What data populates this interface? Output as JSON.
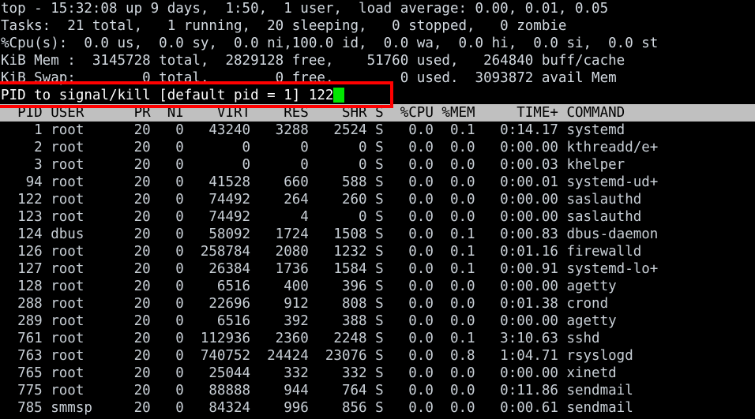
{
  "terminal": {
    "background_color": "#000000",
    "foreground_color": "#cfd6de",
    "header_bar_bg": "#c0c0c0",
    "header_bar_fg": "#000000",
    "cursor_color": "#00e800",
    "annotation_color": "#ff0000"
  },
  "summary": {
    "uptime_line": "top - 15:32:08 up 9 days,  1:50,  1 user,  load average: 0.00, 0.01, 0.05",
    "tasks_line": "Tasks:  21 total,   1 running,  20 sleeping,   0 stopped,   0 zombie",
    "cpu_line": "%Cpu(s):  0.0 us,  0.0 sy,  0.0 ni,100.0 id,  0.0 wa,  0.0 hi,  0.0 si,  0.0 st",
    "mem_line": "KiB Mem :  3145728 total,  2829128 free,    51760 used,   264840 buff/cache",
    "swap_line": "KiB Swap:        0 total,        0 free,        0 used.  3093872 avail Mem",
    "fields": {
      "time": "15:32:08",
      "up_days": "9 days",
      "up_time": "1:50",
      "users": "1 user",
      "load_avg_1": "0.00",
      "load_avg_5": "0.01",
      "load_avg_15": "0.05",
      "tasks_total": "21",
      "tasks_running": "1",
      "tasks_sleeping": "20",
      "tasks_stopped": "0",
      "tasks_zombie": "0",
      "cpu_us": "0.0",
      "cpu_sy": "0.0",
      "cpu_ni": "0.0",
      "cpu_id": "100.0",
      "cpu_wa": "0.0",
      "cpu_hi": "0.0",
      "cpu_si": "0.0",
      "cpu_st": "0.0",
      "mem_total": "3145728",
      "mem_free": "2829128",
      "mem_used": "51760",
      "mem_buff_cache": "264840",
      "swap_total": "0",
      "swap_free": "0",
      "swap_used": "0",
      "avail_mem": "3093872"
    }
  },
  "prompt": {
    "text": "PID to signal/kill [default pid = 1] ",
    "typed_value": "122",
    "full_line": "PID to signal/kill [default pid = 1] 122",
    "default_pid": "1"
  },
  "column_header_line": "  PID USER      PR  NI    VIRT    RES    SHR S  %CPU %MEM     TIME+ COMMAND",
  "columns": [
    "PID",
    "USER",
    "PR",
    "NI",
    "VIRT",
    "RES",
    "SHR",
    "S",
    "%CPU",
    "%MEM",
    "TIME+",
    "COMMAND"
  ],
  "processes": [
    {
      "line": "    1 root      20   0   43240   3288   2524 S   0.0  0.1   0:14.17 systemd",
      "pid": "1",
      "user": "root",
      "pr": "20",
      "ni": "0",
      "virt": "43240",
      "res": "3288",
      "shr": "2524",
      "s": "S",
      "cpu": "0.0",
      "mem": "0.1",
      "time": "0:14.17",
      "command": "systemd"
    },
    {
      "line": "    2 root      20   0       0      0      0 S   0.0  0.0   0:00.00 kthreadd/e+",
      "pid": "2",
      "user": "root",
      "pr": "20",
      "ni": "0",
      "virt": "0",
      "res": "0",
      "shr": "0",
      "s": "S",
      "cpu": "0.0",
      "mem": "0.0",
      "time": "0:00.00",
      "command": "kthreadd/e+"
    },
    {
      "line": "    3 root      20   0       0      0      0 S   0.0  0.0   0:00.03 khelper",
      "pid": "3",
      "user": "root",
      "pr": "20",
      "ni": "0",
      "virt": "0",
      "res": "0",
      "shr": "0",
      "s": "S",
      "cpu": "0.0",
      "mem": "0.0",
      "time": "0:00.03",
      "command": "khelper"
    },
    {
      "line": "   94 root      20   0   41528    660    588 S   0.0  0.0   0:00.01 systemd-ud+",
      "pid": "94",
      "user": "root",
      "pr": "20",
      "ni": "0",
      "virt": "41528",
      "res": "660",
      "shr": "588",
      "s": "S",
      "cpu": "0.0",
      "mem": "0.0",
      "time": "0:00.01",
      "command": "systemd-ud+"
    },
    {
      "line": "  122 root      20   0   74492    264    260 S   0.0  0.0   0:00.00 saslauthd",
      "pid": "122",
      "user": "root",
      "pr": "20",
      "ni": "0",
      "virt": "74492",
      "res": "264",
      "shr": "260",
      "s": "S",
      "cpu": "0.0",
      "mem": "0.0",
      "time": "0:00.00",
      "command": "saslauthd"
    },
    {
      "line": "  123 root      20   0   74492      4      0 S   0.0  0.0   0:00.00 saslauthd",
      "pid": "123",
      "user": "root",
      "pr": "20",
      "ni": "0",
      "virt": "74492",
      "res": "4",
      "shr": "0",
      "s": "S",
      "cpu": "0.0",
      "mem": "0.0",
      "time": "0:00.00",
      "command": "saslauthd"
    },
    {
      "line": "  124 dbus      20   0   58092   1724   1508 S   0.0  0.1   0:00.83 dbus-daemon",
      "pid": "124",
      "user": "dbus",
      "pr": "20",
      "ni": "0",
      "virt": "58092",
      "res": "1724",
      "shr": "1508",
      "s": "S",
      "cpu": "0.0",
      "mem": "0.1",
      "time": "0:00.83",
      "command": "dbus-daemon"
    },
    {
      "line": "  126 root      20   0  258784   2080   1232 S   0.0  0.1   0:01.16 firewalld",
      "pid": "126",
      "user": "root",
      "pr": "20",
      "ni": "0",
      "virt": "258784",
      "res": "2080",
      "shr": "1232",
      "s": "S",
      "cpu": "0.0",
      "mem": "0.1",
      "time": "0:01.16",
      "command": "firewalld"
    },
    {
      "line": "  127 root      20   0   26384   1736   1584 S   0.0  0.1   0:00.91 systemd-lo+",
      "pid": "127",
      "user": "root",
      "pr": "20",
      "ni": "0",
      "virt": "26384",
      "res": "1736",
      "shr": "1584",
      "s": "S",
      "cpu": "0.0",
      "mem": "0.1",
      "time": "0:00.91",
      "command": "systemd-lo+"
    },
    {
      "line": "  128 root      20   0    6516    400    396 S   0.0  0.0   0:00.00 agetty",
      "pid": "128",
      "user": "root",
      "pr": "20",
      "ni": "0",
      "virt": "6516",
      "res": "400",
      "shr": "396",
      "s": "S",
      "cpu": "0.0",
      "mem": "0.0",
      "time": "0:00.00",
      "command": "agetty"
    },
    {
      "line": "  288 root      20   0   22696    912    808 S   0.0  0.0   0:01.38 crond",
      "pid": "288",
      "user": "root",
      "pr": "20",
      "ni": "0",
      "virt": "22696",
      "res": "912",
      "shr": "808",
      "s": "S",
      "cpu": "0.0",
      "mem": "0.0",
      "time": "0:01.38",
      "command": "crond"
    },
    {
      "line": "  289 root      20   0    6516    392    388 S   0.0  0.0   0:00.00 agetty",
      "pid": "289",
      "user": "root",
      "pr": "20",
      "ni": "0",
      "virt": "6516",
      "res": "392",
      "shr": "388",
      "s": "S",
      "cpu": "0.0",
      "mem": "0.0",
      "time": "0:00.00",
      "command": "agetty"
    },
    {
      "line": "  761 root      20   0  112936   2360   2248 S   0.0  0.1   3:10.63 sshd",
      "pid": "761",
      "user": "root",
      "pr": "20",
      "ni": "0",
      "virt": "112936",
      "res": "2360",
      "shr": "2248",
      "s": "S",
      "cpu": "0.0",
      "mem": "0.1",
      "time": "3:10.63",
      "command": "sshd"
    },
    {
      "line": "  763 root      20   0  740752  24424  23076 S   0.0  0.8   1:04.71 rsyslogd",
      "pid": "763",
      "user": "root",
      "pr": "20",
      "ni": "0",
      "virt": "740752",
      "res": "24424",
      "shr": "23076",
      "s": "S",
      "cpu": "0.0",
      "mem": "0.8",
      "time": "1:04.71",
      "command": "rsyslogd"
    },
    {
      "line": "  765 root      20   0   25044    332    332 S   0.0  0.0   0:00.00 xinetd",
      "pid": "765",
      "user": "root",
      "pr": "20",
      "ni": "0",
      "virt": "25044",
      "res": "332",
      "shr": "332",
      "s": "S",
      "cpu": "0.0",
      "mem": "0.0",
      "time": "0:00.00",
      "command": "xinetd"
    },
    {
      "line": "  775 root      20   0   88888    944    764 S   0.0  0.0   0:11.86 sendmail",
      "pid": "775",
      "user": "root",
      "pr": "20",
      "ni": "0",
      "virt": "88888",
      "res": "944",
      "shr": "764",
      "s": "S",
      "cpu": "0.0",
      "mem": "0.0",
      "time": "0:11.86",
      "command": "sendmail"
    },
    {
      "line": "  785 smmsp     20   0   84324    996    856 S   0.0  0.0   0:00.61 sendmail",
      "pid": "785",
      "user": "smmsp",
      "pr": "20",
      "ni": "0",
      "virt": "84324",
      "res": "996",
      "shr": "856",
      "s": "S",
      "cpu": "0.0",
      "mem": "0.0",
      "time": "0:00.61",
      "command": "sendmail"
    }
  ]
}
